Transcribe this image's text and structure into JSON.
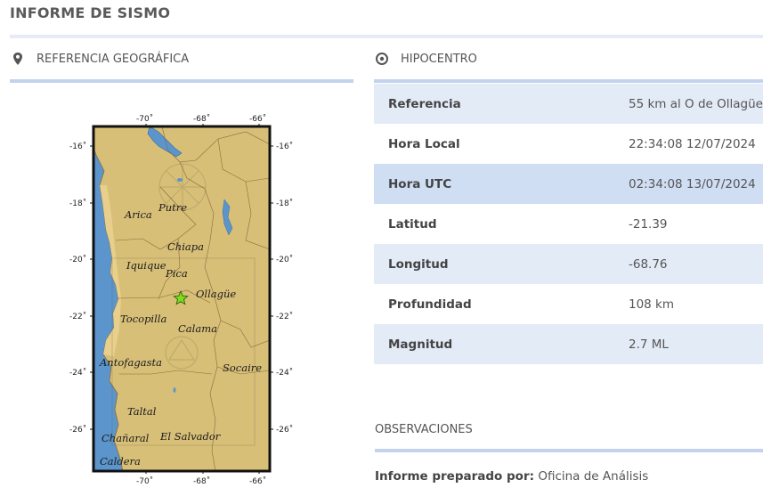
{
  "page": {
    "title": "INFORME DE SISMO"
  },
  "geo": {
    "title": "REFERENCIA GEOGRÁFICA",
    "icon": "map-pin-icon",
    "map": {
      "top_ticks": [
        "-70˚",
        "-68˚",
        "-66˚"
      ],
      "bottom_ticks": [
        "-70˚",
        "-68˚",
        "-66˚"
      ],
      "left_ticks": [
        "-16˚",
        "-18˚",
        "-20˚",
        "-22˚",
        "-24˚",
        "-26˚"
      ],
      "right_ticks": [
        "-16˚",
        "-18˚",
        "-20˚",
        "-22˚",
        "-24˚",
        "-26˚"
      ],
      "places": [
        "Putre",
        "Arica",
        "Chiapa",
        "Iquique",
        "Pica",
        "Ollagüe",
        "Tocopilla",
        "Calama",
        "Antofagasta",
        "Socaire",
        "Taltal",
        "Chañaral",
        "El Salvador",
        "Caldera"
      ],
      "epicenter_icon": "star-icon",
      "colors": {
        "ocean": "#5b95cc",
        "land": "#d7bf78",
        "star": "#7ddc1f"
      }
    }
  },
  "hypo": {
    "title": "HIPOCENTRO",
    "icon": "target-icon",
    "rows": [
      {
        "label": "Referencia",
        "value": "55 km al O de Ollagüe"
      },
      {
        "label": "Hora Local",
        "value": "22:34:08 12/07/2024"
      },
      {
        "label": "Hora UTC",
        "value": "02:34:08 13/07/2024"
      },
      {
        "label": "Latitud",
        "value": "-21.39"
      },
      {
        "label": "Longitud",
        "value": "-68.76"
      },
      {
        "label": "Profundidad",
        "value": "108 km"
      },
      {
        "label": "Magnitud",
        "value": "2.7 ML"
      }
    ]
  },
  "obs": {
    "title": "OBSERVACIONES",
    "prepared_label": "Informe preparado por:",
    "prepared_value": "Oficina de Análisis"
  }
}
